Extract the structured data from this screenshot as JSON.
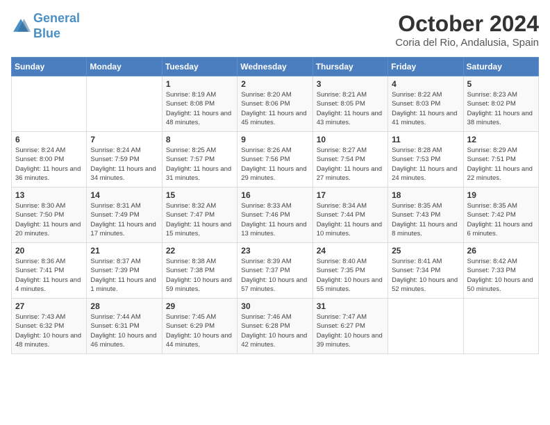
{
  "header": {
    "logo_line1": "General",
    "logo_line2": "Blue",
    "month_title": "October 2024",
    "subtitle": "Coria del Rio, Andalusia, Spain"
  },
  "weekdays": [
    "Sunday",
    "Monday",
    "Tuesday",
    "Wednesday",
    "Thursday",
    "Friday",
    "Saturday"
  ],
  "weeks": [
    [
      {
        "day": "",
        "sunrise": "",
        "sunset": "",
        "daylight": ""
      },
      {
        "day": "",
        "sunrise": "",
        "sunset": "",
        "daylight": ""
      },
      {
        "day": "1",
        "sunrise": "Sunrise: 8:19 AM",
        "sunset": "Sunset: 8:08 PM",
        "daylight": "Daylight: 11 hours and 48 minutes."
      },
      {
        "day": "2",
        "sunrise": "Sunrise: 8:20 AM",
        "sunset": "Sunset: 8:06 PM",
        "daylight": "Daylight: 11 hours and 45 minutes."
      },
      {
        "day": "3",
        "sunrise": "Sunrise: 8:21 AM",
        "sunset": "Sunset: 8:05 PM",
        "daylight": "Daylight: 11 hours and 43 minutes."
      },
      {
        "day": "4",
        "sunrise": "Sunrise: 8:22 AM",
        "sunset": "Sunset: 8:03 PM",
        "daylight": "Daylight: 11 hours and 41 minutes."
      },
      {
        "day": "5",
        "sunrise": "Sunrise: 8:23 AM",
        "sunset": "Sunset: 8:02 PM",
        "daylight": "Daylight: 11 hours and 38 minutes."
      }
    ],
    [
      {
        "day": "6",
        "sunrise": "Sunrise: 8:24 AM",
        "sunset": "Sunset: 8:00 PM",
        "daylight": "Daylight: 11 hours and 36 minutes."
      },
      {
        "day": "7",
        "sunrise": "Sunrise: 8:24 AM",
        "sunset": "Sunset: 7:59 PM",
        "daylight": "Daylight: 11 hours and 34 minutes."
      },
      {
        "day": "8",
        "sunrise": "Sunrise: 8:25 AM",
        "sunset": "Sunset: 7:57 PM",
        "daylight": "Daylight: 11 hours and 31 minutes."
      },
      {
        "day": "9",
        "sunrise": "Sunrise: 8:26 AM",
        "sunset": "Sunset: 7:56 PM",
        "daylight": "Daylight: 11 hours and 29 minutes."
      },
      {
        "day": "10",
        "sunrise": "Sunrise: 8:27 AM",
        "sunset": "Sunset: 7:54 PM",
        "daylight": "Daylight: 11 hours and 27 minutes."
      },
      {
        "day": "11",
        "sunrise": "Sunrise: 8:28 AM",
        "sunset": "Sunset: 7:53 PM",
        "daylight": "Daylight: 11 hours and 24 minutes."
      },
      {
        "day": "12",
        "sunrise": "Sunrise: 8:29 AM",
        "sunset": "Sunset: 7:51 PM",
        "daylight": "Daylight: 11 hours and 22 minutes."
      }
    ],
    [
      {
        "day": "13",
        "sunrise": "Sunrise: 8:30 AM",
        "sunset": "Sunset: 7:50 PM",
        "daylight": "Daylight: 11 hours and 20 minutes."
      },
      {
        "day": "14",
        "sunrise": "Sunrise: 8:31 AM",
        "sunset": "Sunset: 7:49 PM",
        "daylight": "Daylight: 11 hours and 17 minutes."
      },
      {
        "day": "15",
        "sunrise": "Sunrise: 8:32 AM",
        "sunset": "Sunset: 7:47 PM",
        "daylight": "Daylight: 11 hours and 15 minutes."
      },
      {
        "day": "16",
        "sunrise": "Sunrise: 8:33 AM",
        "sunset": "Sunset: 7:46 PM",
        "daylight": "Daylight: 11 hours and 13 minutes."
      },
      {
        "day": "17",
        "sunrise": "Sunrise: 8:34 AM",
        "sunset": "Sunset: 7:44 PM",
        "daylight": "Daylight: 11 hours and 10 minutes."
      },
      {
        "day": "18",
        "sunrise": "Sunrise: 8:35 AM",
        "sunset": "Sunset: 7:43 PM",
        "daylight": "Daylight: 11 hours and 8 minutes."
      },
      {
        "day": "19",
        "sunrise": "Sunrise: 8:35 AM",
        "sunset": "Sunset: 7:42 PM",
        "daylight": "Daylight: 11 hours and 6 minutes."
      }
    ],
    [
      {
        "day": "20",
        "sunrise": "Sunrise: 8:36 AM",
        "sunset": "Sunset: 7:41 PM",
        "daylight": "Daylight: 11 hours and 4 minutes."
      },
      {
        "day": "21",
        "sunrise": "Sunrise: 8:37 AM",
        "sunset": "Sunset: 7:39 PM",
        "daylight": "Daylight: 11 hours and 1 minute."
      },
      {
        "day": "22",
        "sunrise": "Sunrise: 8:38 AM",
        "sunset": "Sunset: 7:38 PM",
        "daylight": "Daylight: 10 hours and 59 minutes."
      },
      {
        "day": "23",
        "sunrise": "Sunrise: 8:39 AM",
        "sunset": "Sunset: 7:37 PM",
        "daylight": "Daylight: 10 hours and 57 minutes."
      },
      {
        "day": "24",
        "sunrise": "Sunrise: 8:40 AM",
        "sunset": "Sunset: 7:35 PM",
        "daylight": "Daylight: 10 hours and 55 minutes."
      },
      {
        "day": "25",
        "sunrise": "Sunrise: 8:41 AM",
        "sunset": "Sunset: 7:34 PM",
        "daylight": "Daylight: 10 hours and 52 minutes."
      },
      {
        "day": "26",
        "sunrise": "Sunrise: 8:42 AM",
        "sunset": "Sunset: 7:33 PM",
        "daylight": "Daylight: 10 hours and 50 minutes."
      }
    ],
    [
      {
        "day": "27",
        "sunrise": "Sunrise: 7:43 AM",
        "sunset": "Sunset: 6:32 PM",
        "daylight": "Daylight: 10 hours and 48 minutes."
      },
      {
        "day": "28",
        "sunrise": "Sunrise: 7:44 AM",
        "sunset": "Sunset: 6:31 PM",
        "daylight": "Daylight: 10 hours and 46 minutes."
      },
      {
        "day": "29",
        "sunrise": "Sunrise: 7:45 AM",
        "sunset": "Sunset: 6:29 PM",
        "daylight": "Daylight: 10 hours and 44 minutes."
      },
      {
        "day": "30",
        "sunrise": "Sunrise: 7:46 AM",
        "sunset": "Sunset: 6:28 PM",
        "daylight": "Daylight: 10 hours and 42 minutes."
      },
      {
        "day": "31",
        "sunrise": "Sunrise: 7:47 AM",
        "sunset": "Sunset: 6:27 PM",
        "daylight": "Daylight: 10 hours and 39 minutes."
      },
      {
        "day": "",
        "sunrise": "",
        "sunset": "",
        "daylight": ""
      },
      {
        "day": "",
        "sunrise": "",
        "sunset": "",
        "daylight": ""
      }
    ]
  ]
}
